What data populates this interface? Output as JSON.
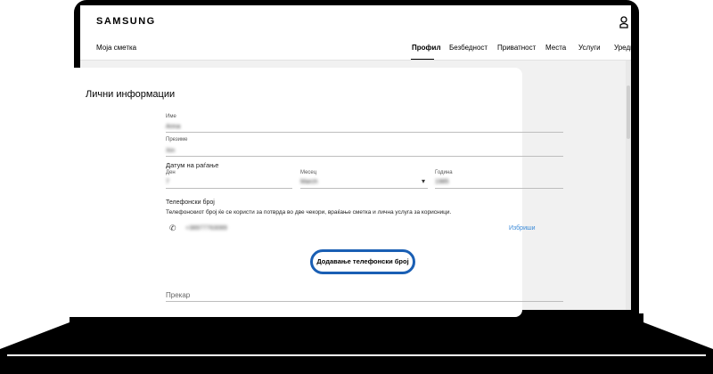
{
  "header": {
    "logo": "SAMSUNG",
    "account_title": "Моја сметка",
    "nav": [
      {
        "label": "Профил",
        "active": true
      },
      {
        "label": "Безбедност",
        "active": false
      },
      {
        "label": "Приватност",
        "active": false
      },
      {
        "label": "Места",
        "active": false
      },
      {
        "label": "Услуги",
        "active": false
      },
      {
        "label": "Уреди",
        "active": false
      }
    ]
  },
  "personal_info": {
    "title": "Лични информации",
    "first_name": {
      "label": "Име",
      "value": "Anna"
    },
    "last_name": {
      "label": "Презиме",
      "value": "Xin"
    },
    "dob": {
      "label": "Датум на раѓање",
      "day": {
        "label": "Ден",
        "value": "7"
      },
      "month": {
        "label": "Месец",
        "value": "March"
      },
      "year": {
        "label": "Година",
        "value": "1985"
      }
    },
    "phone": {
      "label": "Телефонски број",
      "description": "Телефонскиот број ќе се користи за потврда во две чекори, враќање сметка и лична услуга за корисници.",
      "number": "+38977763089",
      "delete_label": "Избриши",
      "add_label": "Додавање телефонски број"
    },
    "nickname": {
      "label": "Прекар"
    }
  },
  "icons": {
    "user": "user-icon",
    "phone": "phone-icon",
    "dropdown": "chevron-down-icon"
  },
  "colors": {
    "accent": "#1a5fb4",
    "link": "#3a8ad8"
  }
}
